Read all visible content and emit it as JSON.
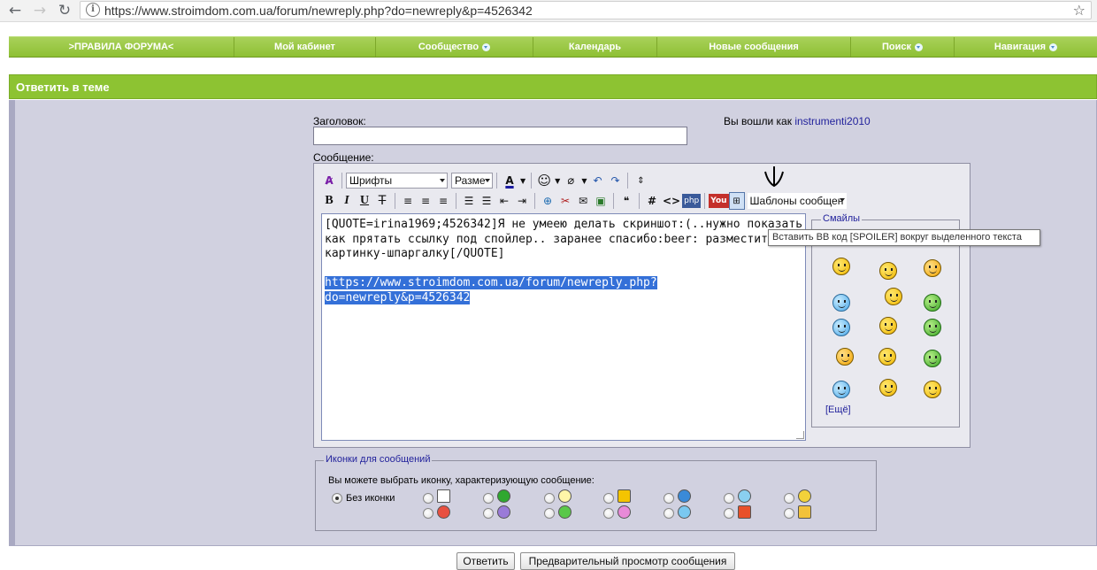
{
  "browser": {
    "url": "https://www.stroimdom.com.ua/forum/newreply.php?do=newreply&p=4526342"
  },
  "nav": [
    {
      "label": ">ПРАВИЛА ФОРУМА<",
      "dropdown": false
    },
    {
      "label": "Мой кабинет",
      "dropdown": false
    },
    {
      "label": "Сообщество",
      "dropdown": true
    },
    {
      "label": "Календарь",
      "dropdown": false
    },
    {
      "label": "Новые сообщения",
      "dropdown": false
    },
    {
      "label": "Поиск",
      "dropdown": true
    },
    {
      "label": "Навигация",
      "dropdown": true
    }
  ],
  "panel": {
    "title": "Ответить в теме",
    "title_label": "Заголовок:",
    "title_value": "",
    "message_label": "Сообщение:",
    "logged_in_prefix": "Вы вошли как",
    "username": "instrumenti2010"
  },
  "editor": {
    "font_select": "Шрифты",
    "size_select": "Разме",
    "template_select": "Шаблоны сообщен",
    "content_line1": "[QUOTE=irina1969;4526342]Я не умеею делать скриншот:(..нужно показать",
    "content_line2": "как прятать ссылку под спойлер.. заранее спасибо:beer: разместите зд",
    "content_line3": "картинку-шпаргалку[/QUOTE]",
    "selected_line1": "https://www.stroimdom.com.ua/forum/newreply.php?",
    "selected_line2": "do=newreply&p=4526342",
    "tooltip": "Вставить BB код [SPOILER] вокруг выделенного текста"
  },
  "smilies": {
    "legend": "Смайлы",
    "more": "[Ещё]"
  },
  "post_icons": {
    "legend": "Иконки для сообщений",
    "description": "Вы можете выбрать иконку, характеризующую сообщение:",
    "no_icon_label": "Без иконки",
    "selected": "none"
  },
  "buttons": {
    "submit": "Ответить",
    "preview": "Предварительный просмотр сообщения"
  },
  "colors": {
    "nav_green": "#8ec034",
    "panel_bg": "#d1d1e0",
    "link_blue": "#22229c",
    "selection": "#3470d8"
  }
}
